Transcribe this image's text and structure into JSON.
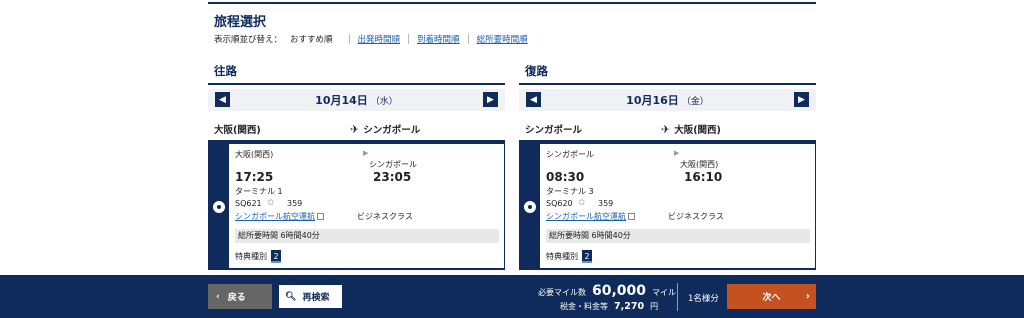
{
  "page_title": "旅程選択",
  "sort": {
    "label": "表示順並び替え：",
    "current": "おすすめ順",
    "options": [
      "出発時間順",
      "到着時間順",
      "総所要時間順"
    ]
  },
  "outbound": {
    "heading": "往路",
    "date_main": "10月14日",
    "date_weekday": "（水）",
    "from": "大阪(関西)",
    "to": "シンガポール",
    "flight": {
      "dep_city": "大阪(関西)",
      "arr_city": "シンガポール",
      "dep_time": "17:25",
      "arr_time": "23:05",
      "terminal": "ターミナル 1",
      "flight_no": "SQ621",
      "aircraft": "359",
      "airline": "シンガポール航空運航",
      "cabin": "ビジネスクラス",
      "duration": "総所要時間  6時間40分",
      "award_label": "特典種別",
      "award_value": "2"
    }
  },
  "inbound": {
    "heading": "復路",
    "date_main": "10月16日",
    "date_weekday": "（金）",
    "from": "シンガポール",
    "to": "大阪(関西)",
    "flight": {
      "dep_city": "シンガポール",
      "arr_city": "大阪(関西)",
      "dep_time": "08:30",
      "arr_time": "16:10",
      "terminal": "ターミナル 3",
      "flight_no": "SQ620",
      "aircraft": "359",
      "airline": "シンガポール航空運航",
      "cabin": "ビジネスクラス",
      "duration": "総所要時間  6時間40分",
      "award_label": "特典種別",
      "award_value": "2"
    }
  },
  "footer": {
    "back": "戻る",
    "research": "再検索",
    "miles_label": "必要マイル数",
    "miles_value": "60,000",
    "miles_unit": "マイル",
    "tax_label": "税金・料金等",
    "tax_value": "7,270",
    "tax_unit": "円",
    "pax": "1名様分",
    "next": "次へ"
  },
  "colors": {
    "navy": "#0f2b5b",
    "accent": "#c4511f",
    "link": "#1a5fb4"
  }
}
